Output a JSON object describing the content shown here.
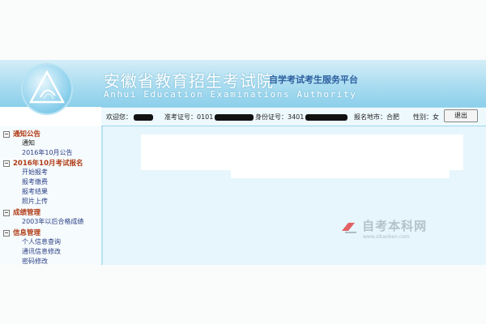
{
  "header": {
    "title_cn": "安徽省教育招生考试院",
    "subtitle": "自学考试考生服务平台",
    "title_en": "Anhui Education Examinations Authority"
  },
  "infobar": {
    "welcome_label": "欢迎您：",
    "ticket_label": "准考证号：",
    "ticket_value": "0101",
    "id_label": "身份证号：",
    "id_value": "3401",
    "region_label": "报名地市：",
    "region_value": "合肥",
    "gender_label": "性别：",
    "gender_value": "女",
    "logout_label": "退出"
  },
  "sidebar": {
    "sections": [
      {
        "title": "通知公告",
        "items": [
          "通知",
          "2016年10月公告"
        ]
      },
      {
        "title": "2016年10月考试报名",
        "items": [
          "开始报考",
          "报考缴费",
          "报考结果",
          "照片上传"
        ]
      },
      {
        "title": "成绩管理",
        "items": [
          "2003年以后合格成绩"
        ]
      },
      {
        "title": "信息管理",
        "items": [
          "个人信息查询",
          "通讯信息修改",
          "密码修改"
        ]
      }
    ]
  },
  "watermark": {
    "text": "自考本科网",
    "url": "www.zikaoben.com"
  },
  "colors": {
    "header_top": "#d5eef8",
    "header_bottom": "#8ccfeb",
    "section_title": "#b03a14",
    "nav_link": "#2b3f86",
    "main_bg": "#e6f6fc"
  }
}
